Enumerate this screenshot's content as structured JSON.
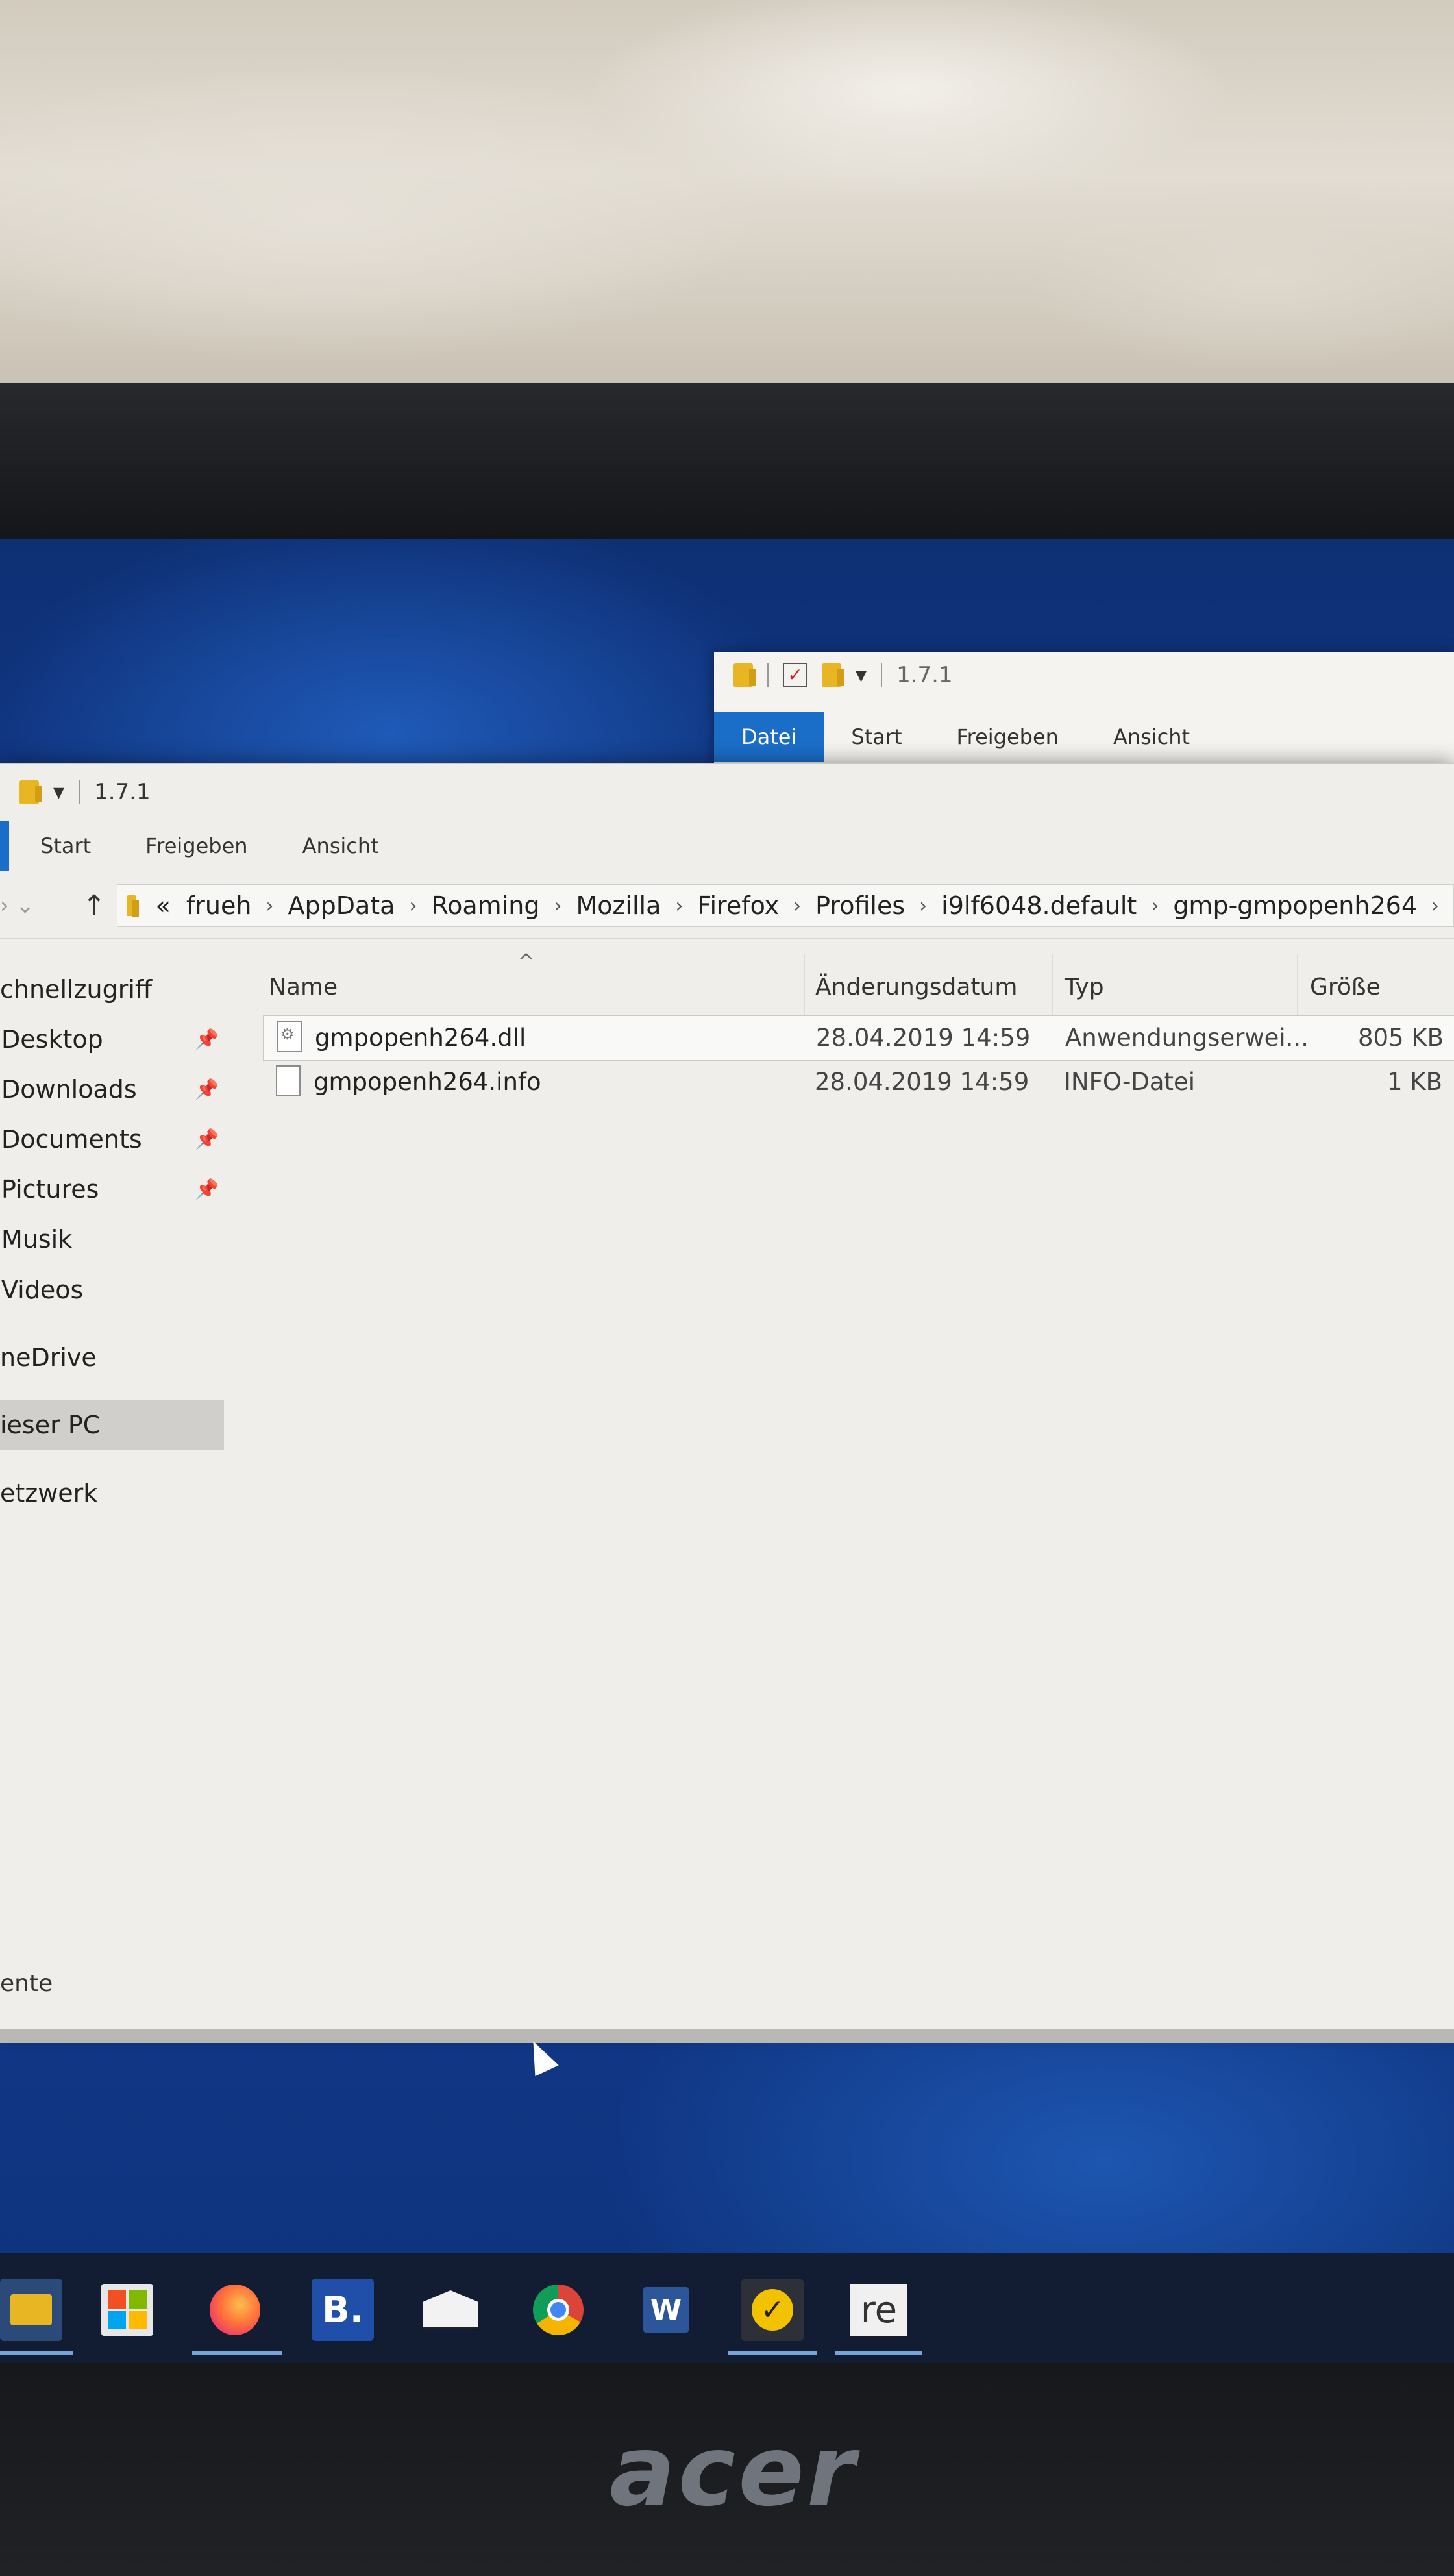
{
  "back_window": {
    "title": "1.7.1",
    "tabs": [
      "Datei",
      "Start",
      "Freigeben",
      "Ansicht"
    ]
  },
  "main_window": {
    "title": "1.7.1",
    "tabs": [
      "Start",
      "Freigeben",
      "Ansicht"
    ],
    "breadcrumb": [
      "«",
      "frueh",
      "AppData",
      "Roaming",
      "Mozilla",
      "Firefox",
      "Profiles",
      "i9lf6048.default",
      "gmp-gmpopenh264"
    ],
    "breadcrumb_separator": "›",
    "nav_items": [
      {
        "label": "chnellzugriff",
        "pinned": false
      },
      {
        "label": "Desktop",
        "pinned": true
      },
      {
        "label": "Downloads",
        "pinned": true
      },
      {
        "label": "Documents",
        "pinned": true
      },
      {
        "label": "Pictures",
        "pinned": true
      },
      {
        "label": "Musik",
        "pinned": false
      },
      {
        "label": "Videos",
        "pinned": false
      },
      {
        "label": "neDrive",
        "pinned": false
      },
      {
        "label": "ieser PC",
        "pinned": false,
        "selected": true
      },
      {
        "label": "etzwerk",
        "pinned": false
      }
    ],
    "columns": {
      "name": "Name",
      "date": "Änderungsdatum",
      "type": "Typ",
      "size": "Größe"
    },
    "files": [
      {
        "name": "gmpopenh264.dll",
        "date": "28.04.2019 14:59",
        "type": "Anwendungserwei...",
        "size": "805 KB",
        "icon": "dll-file-icon"
      },
      {
        "name": "gmpopenh264.info",
        "date": "28.04.2019 14:59",
        "type": "INFO-Datei",
        "size": "1 KB",
        "icon": "generic-file-icon"
      }
    ],
    "status": "ente"
  },
  "taskbar": {
    "icons": [
      "file-explorer-icon",
      "store-icon",
      "firefox-icon",
      "booking-icon",
      "mail-icon",
      "chrome-icon",
      "word-icon",
      "norton-icon",
      "re-icon"
    ],
    "b_label": "B.",
    "w_label": "W",
    "re_label": "re"
  },
  "brand": "acer",
  "colors": {
    "accent": "#1b6ec8",
    "desktop": "#14409a",
    "window": "#efeeeb"
  }
}
